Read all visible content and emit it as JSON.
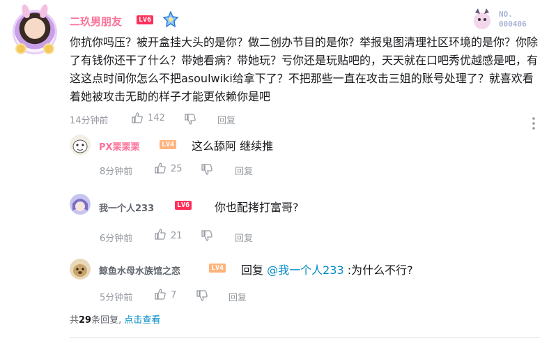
{
  "main_comment": {
    "username": "二玖男朋友",
    "level": "LV6",
    "content": "你抗你吗压？被开盒挂大头的是你？做二创办节目的是你？举报鬼图清理社区环境的是你？你除了有钱你还干了什么？带她看病？带她玩？亏你还是玩贴吧的，天天就在口吧秀优越感是吧，有这这点时间你怎么不把asoulwiki给拿下了？不把那些一直在攻击三姐的账号处理了？就喜欢看着她被攻击无助的样子才能更依赖你是吧",
    "time": "14分钟前",
    "likes": "142",
    "reply_label": "回复",
    "sticker_text": "NO.\n000406",
    "name_color": "#fb7299"
  },
  "replies": [
    {
      "username": "PX栗栗栗",
      "level": "LV4",
      "content": "这么舔阿 继续推",
      "time": "8分钟前",
      "likes": "25",
      "reply_label": "回复",
      "name_color": "#fb7299"
    },
    {
      "username": "我一个人233",
      "level": "LV6",
      "content": "你也配拷打富哥?",
      "time": "6分钟前",
      "likes": "21",
      "reply_label": "回复",
      "name_color": "#61666d"
    },
    {
      "username": "鲸鱼水母水族馆之恋",
      "level": "LV4",
      "content_prefix": "回复 ",
      "mention": "@我一个人233",
      "content_suffix": " :为什么不行?",
      "time": "5分钟前",
      "likes": "7",
      "reply_label": "回复",
      "name_color": "#61666d"
    }
  ],
  "footer": {
    "prefix": "共",
    "count": "29",
    "suffix": "条回复,",
    "view_link": "点击查看"
  },
  "icons": {
    "like": "thumbs-up-icon",
    "dislike": "thumbs-down-icon",
    "more": "more-vertical-icon"
  }
}
